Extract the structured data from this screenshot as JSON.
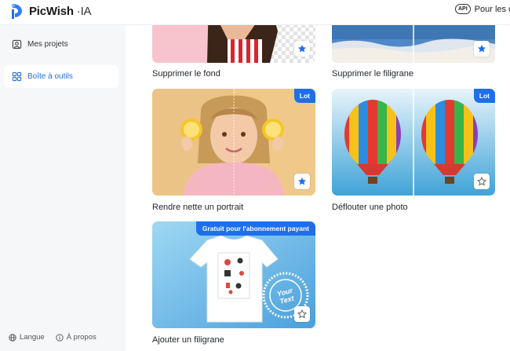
{
  "app": {
    "brand": "PicWish",
    "brand_suffix": "·IA",
    "api_badge": "API",
    "api_link": "Pour les dév"
  },
  "sidebar": {
    "items": [
      {
        "label": "Mes projets",
        "icon": "projects-icon",
        "active": false
      },
      {
        "label": "Boîte à outils",
        "icon": "toolbox-icon",
        "active": true
      }
    ],
    "footer": [
      {
        "label": "Langue",
        "icon": "globe-icon"
      },
      {
        "label": "À propos",
        "icon": "info-icon"
      }
    ]
  },
  "tools": [
    {
      "title": "Supprimer le fond",
      "favorited": true
    },
    {
      "title": "Supprimer le filigrane",
      "favorited": true
    },
    {
      "title": "Rendre nette un portrait",
      "badge": "Lot",
      "favorited": true
    },
    {
      "title": "Déflouter une photo",
      "badge": "Lot",
      "favorited": false
    },
    {
      "title": "Ajouter un filigrane",
      "badge": "Gratuit pour l'abonnement payant",
      "favorited": false,
      "stamp_text_1": "Your",
      "stamp_text_2": "Text"
    }
  ],
  "colors": {
    "accent": "#1f6feb",
    "sidebar_bg": "#f6f7f9",
    "fav_star_filled": "#1f6feb"
  }
}
